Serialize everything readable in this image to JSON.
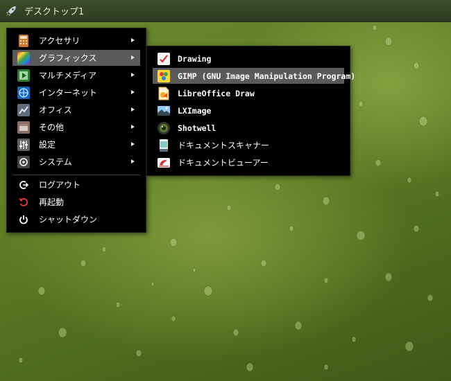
{
  "taskbar": {
    "desktop_label": "デスクトップ1"
  },
  "main_menu": {
    "items": [
      {
        "label": "アクセサリ",
        "icon": "accessories-icon"
      },
      {
        "label": "グラフィックス",
        "icon": "graphics-icon"
      },
      {
        "label": "マルチメディア",
        "icon": "multimedia-icon"
      },
      {
        "label": "インターネット",
        "icon": "internet-icon"
      },
      {
        "label": "オフィス",
        "icon": "office-icon"
      },
      {
        "label": "その他",
        "icon": "other-icon"
      },
      {
        "label": "設定",
        "icon": "settings-icon"
      },
      {
        "label": "システム",
        "icon": "system-icon"
      }
    ],
    "actions": [
      {
        "label": "ログアウト",
        "icon": "logout-icon"
      },
      {
        "label": "再起動",
        "icon": "restart-icon"
      },
      {
        "label": "シャットダウン",
        "icon": "power-icon"
      }
    ]
  },
  "graphics_submenu": {
    "items": [
      {
        "label": "Drawing",
        "icon": "drawing-app-icon"
      },
      {
        "label": "GIMP (GNU Image Manipulation Program)",
        "icon": "gimp-icon"
      },
      {
        "label": "LibreOffice Draw",
        "icon": "libreoffice-draw-icon"
      },
      {
        "label": "LXImage",
        "icon": "lximage-icon"
      },
      {
        "label": "Shotwell",
        "icon": "shotwell-icon"
      },
      {
        "label": "ドキュメントスキャナー",
        "icon": "document-scanner-icon"
      },
      {
        "label": "ドキュメントビューアー",
        "icon": "document-viewer-icon"
      }
    ]
  },
  "state": {
    "highlighted_category": "グラフィックス",
    "highlighted_app": "GIMP (GNU Image Manipulation Program)"
  },
  "colors": {
    "menu_bg": "#000000",
    "highlight": "#5a5a5a",
    "text": "#ffffff",
    "wallpaper": "#5f7f27"
  }
}
